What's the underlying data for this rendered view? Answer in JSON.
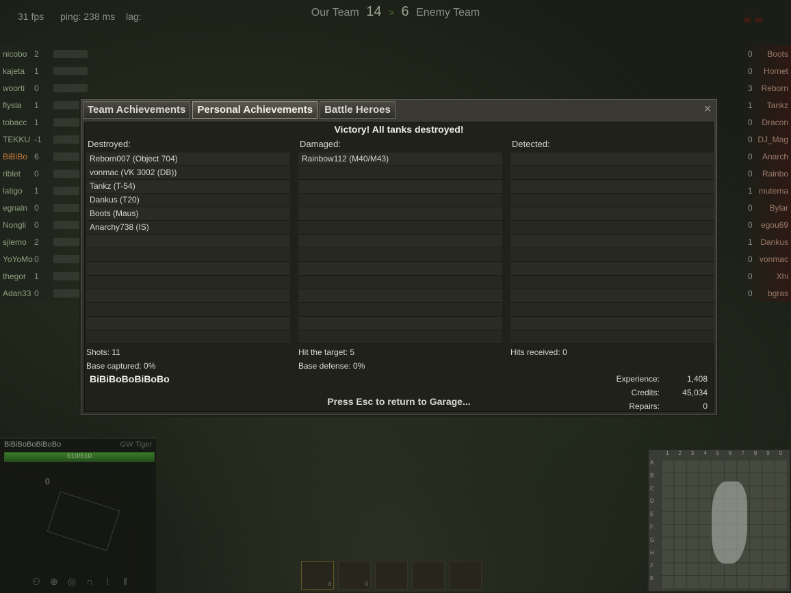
{
  "hud_top": {
    "fps": "31 fps",
    "ping": "ping: 238 ms",
    "lag": "lag:",
    "our_team": "Our Team",
    "our_score": "14",
    "separator": ">",
    "enemy_score": "6",
    "enemy_team": "Enemy Team"
  },
  "roster_left": [
    {
      "name": "nicobo",
      "frags": "2"
    },
    {
      "name": "kajeta",
      "frags": "1"
    },
    {
      "name": "woorti",
      "frags": "0"
    },
    {
      "name": "flysla",
      "frags": "1"
    },
    {
      "name": "tobacc",
      "frags": "1"
    },
    {
      "name": "TEKKU",
      "frags": "-1"
    },
    {
      "name": "BiBiBo",
      "frags": "6"
    },
    {
      "name": "riblet",
      "frags": "0"
    },
    {
      "name": "latigo",
      "frags": "1"
    },
    {
      "name": "egnaln",
      "frags": "0"
    },
    {
      "name": "Nongli",
      "frags": "0"
    },
    {
      "name": "sjlemo",
      "frags": "2"
    },
    {
      "name": "YoYoMo",
      "frags": "0"
    },
    {
      "name": "thegor",
      "frags": "1"
    },
    {
      "name": "Adan33",
      "frags": "0"
    }
  ],
  "roster_right": [
    {
      "name": "Boots",
      "frags": "0"
    },
    {
      "name": "Hornet",
      "frags": "0"
    },
    {
      "name": "Reborn",
      "frags": "3"
    },
    {
      "name": "Tankz",
      "frags": "1"
    },
    {
      "name": "Dracon",
      "frags": "0"
    },
    {
      "name": "DJ_Mag",
      "frags": "0"
    },
    {
      "name": "Anarch",
      "frags": "0"
    },
    {
      "name": "Rainbo",
      "frags": "0"
    },
    {
      "name": "mutema",
      "frags": "1"
    },
    {
      "name": "Bylar",
      "frags": "0"
    },
    {
      "name": "egou69",
      "frags": "0"
    },
    {
      "name": "Dankus",
      "frags": "1"
    },
    {
      "name": "vonmac",
      "frags": "0"
    },
    {
      "name": "Xhi",
      "frags": "0"
    },
    {
      "name": "bgras",
      "frags": "0"
    }
  ],
  "dialog": {
    "tabs": [
      "Team Achievements",
      "Personal Achievements",
      "Battle Heroes"
    ],
    "close_icon": "×",
    "headline": "Victory! All tanks destroyed!",
    "destroyed_title": "Destroyed:",
    "damaged_title": "Damaged:",
    "detected_title": "Detected:",
    "destroyed": [
      "Reborn007 (Object 704)",
      "vonmac (VK 3002 (DB))",
      "Tankz (T-54)",
      "Dankus (T20)",
      "Boots (Maus)",
      "Anarchy738 (IS)",
      "",
      "",
      "",
      "",
      "",
      "",
      "",
      ""
    ],
    "damaged": [
      "Rainbow112 (M40/M43)",
      "",
      "",
      "",
      "",
      "",
      "",
      "",
      "",
      "",
      "",
      "",
      "",
      ""
    ],
    "detected": [
      "",
      "",
      "",
      "",
      "",
      "",
      "",
      "",
      "",
      "",
      "",
      "",
      "",
      ""
    ],
    "shots": "Shots: 11",
    "hits": "Hit the target: 5",
    "hits_received": "Hits received: 0",
    "base_captured": "Base captured: 0%",
    "base_defense": "Base defense: 0%",
    "player": "BiBiBoBoBiBoBo",
    "experience_label": "Experience:",
    "experience": "1,408",
    "credits_label": "Credits:",
    "credits": "45,034",
    "repairs_label": "Repairs:",
    "repairs": "0",
    "prompt": "Press Esc to return to Garage..."
  },
  "hud_bottom": {
    "player_name": "BiBiBoBoBiBoBo",
    "tank_name": "GW Tiger",
    "hp_text": "610/610",
    "hp_fraction": 1.0,
    "ammo_count": "0"
  },
  "ammo_slots": [
    {
      "count": "4"
    },
    {
      "count": "0"
    },
    {
      "count": ""
    },
    {
      "count": ""
    },
    {
      "count": ""
    }
  ],
  "minimap": {
    "cols": [
      "1",
      "2",
      "3",
      "4",
      "5",
      "6",
      "7",
      "8",
      "9",
      "0"
    ],
    "rows": [
      "A",
      "B",
      "C",
      "D",
      "E",
      "F",
      "G",
      "H",
      "J",
      "K"
    ]
  }
}
